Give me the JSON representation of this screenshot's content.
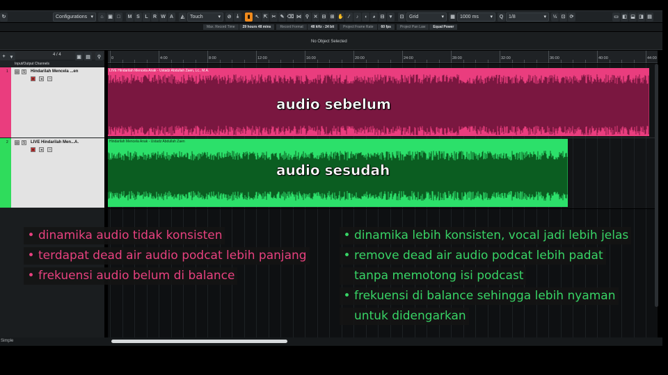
{
  "toolbar": {
    "configurations_label": "Configurations",
    "buttons_msl": [
      "M",
      "S",
      "L",
      "R",
      "W",
      "A"
    ],
    "automation_mode": "Touch",
    "snap_type": "Grid",
    "quantize": "1000 ms",
    "grid_value": "1/8"
  },
  "status": {
    "items": [
      {
        "label": "Max. Record Time",
        "value": "29 hours 48 mins"
      },
      {
        "label": "Record Format",
        "value": "48 kHz - 24 bit"
      },
      {
        "label": "Project Frame Rate",
        "value": "60 fps"
      },
      {
        "label": "Project Pan Law",
        "value": "Equal Power"
      }
    ],
    "info": "No Object Selected"
  },
  "tracklist": {
    "count": "4 / 4",
    "io_channels": "Input/Output Channels",
    "tracks": [
      {
        "num": "1",
        "name": "Hindarilah Mencela ...en",
        "color": "#ea3d7e"
      },
      {
        "num": "2",
        "name": "LIVE  Hindarilah Men...A.",
        "color": "#2fdc5c"
      }
    ]
  },
  "ruler": {
    "labels": [
      "0",
      "4:00",
      "8:00",
      "12:00",
      "16:00",
      "20:00",
      "24:00",
      "28:00",
      "32:00",
      "36:00",
      "40:00",
      "44:00"
    ]
  },
  "clips": [
    {
      "title": "LIVE  Hindarilah Mencela Anak - Ustadz  Abdullah Zaen, Lc., M.A.",
      "overlay": "audio sebelum",
      "color": "#ea3d7e",
      "wave_color": "#7a1740"
    },
    {
      "title": "Hindarilah Mencela Anak - Ustadz  Abdullah Zaen",
      "overlay": "audio sesudah",
      "color": "#2ce06a",
      "wave_color": "#0b5d21"
    }
  ],
  "bottom": {
    "preset": "Simple"
  },
  "notes": {
    "before": {
      "color": "#e8417f",
      "items": [
        "dinamika audio tidak konsisten",
        "terdapat dead air audio podcat lebih panjang",
        "frekuensi audio belum di balance"
      ]
    },
    "after": {
      "color": "#38d466",
      "items": [
        [
          "dinamika lebih konsisten, vocal jadi lebih jelas"
        ],
        [
          "remove dead air audio podcat lebih padat",
          "tanpa memotong isi podcast"
        ],
        [
          "frekuensi di balance sehingga lebih nyaman",
          "untuk didengarkan"
        ]
      ]
    }
  }
}
